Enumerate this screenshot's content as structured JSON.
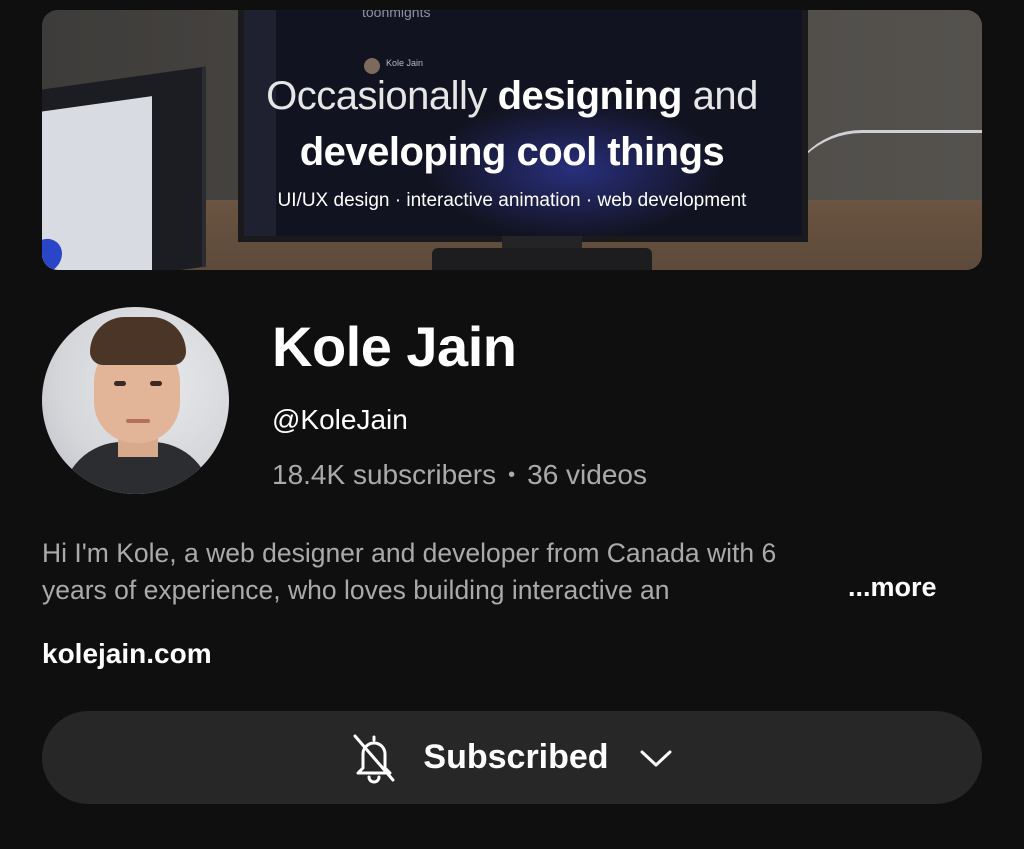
{
  "banner": {
    "headline_part1": "Occasionally",
    "headline_part2": "designing",
    "headline_part3": "and",
    "headline_line2": "developing cool things",
    "subtitle": "UI/UX design · interactive animation · web development",
    "screen_top_text": "toonmights",
    "screen_user_name": "Kole Jain"
  },
  "channel": {
    "name": "Kole Jain",
    "handle": "@KoleJain",
    "subscribers": "18.4K subscribers",
    "separator": "•",
    "videos": "36 videos",
    "description_line1": "Hi I'm Kole, a web designer and developer from Canada with 6",
    "description_line2": "years of experience, who loves building interactive an",
    "more_label": "...more",
    "link": "kolejain.com"
  },
  "subscribe_button": {
    "label": "Subscribed",
    "bell_icon": "bell-slash-icon",
    "chevron_icon": "chevron-down-icon"
  },
  "colors": {
    "background": "#0f0f0f",
    "button_bg": "#272727",
    "secondary_text": "#aaaaaa",
    "primary_text": "#ffffff"
  }
}
